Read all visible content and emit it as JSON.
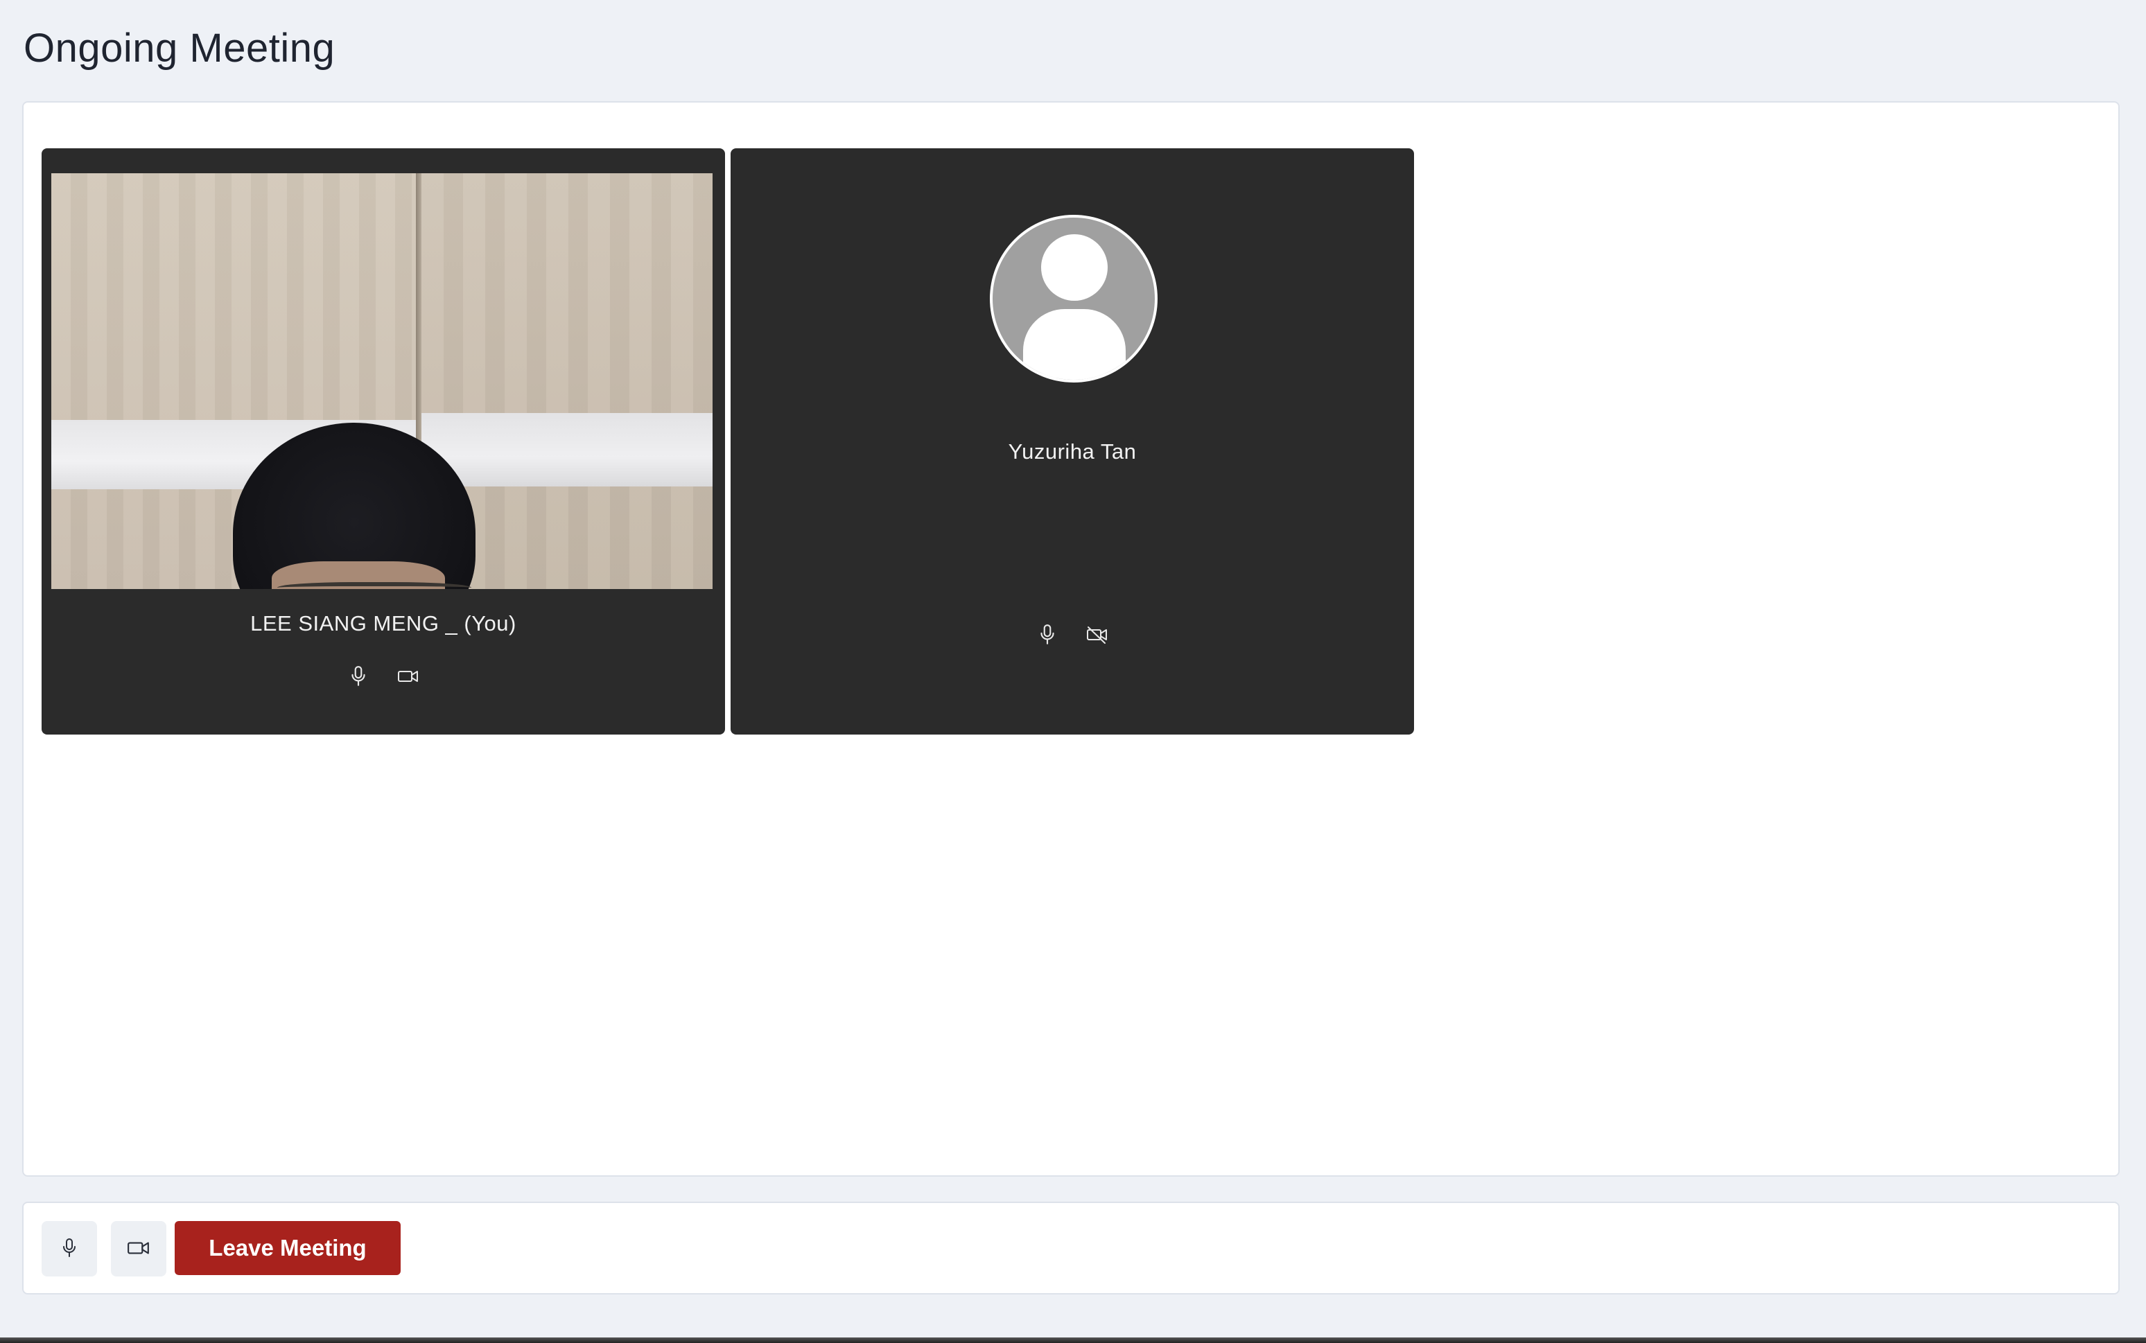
{
  "page": {
    "title": "Ongoing Meeting"
  },
  "participants": [
    {
      "name": "LEE SIANG MENG _ (You)",
      "mic": "mic-on",
      "camera": "camera-on",
      "has_video": true
    },
    {
      "name": "Yuzuriha Tan",
      "mic": "mic-on",
      "camera": "camera-off",
      "has_video": false
    }
  ],
  "controls": {
    "mic_icon": "microphone-icon",
    "camera_icon": "video-camera-icon",
    "leave_label": "Leave Meeting"
  },
  "colors": {
    "tile_background": "#2b2b2b",
    "leave_button": "#a8221d",
    "page_background": "#eef1f6"
  }
}
